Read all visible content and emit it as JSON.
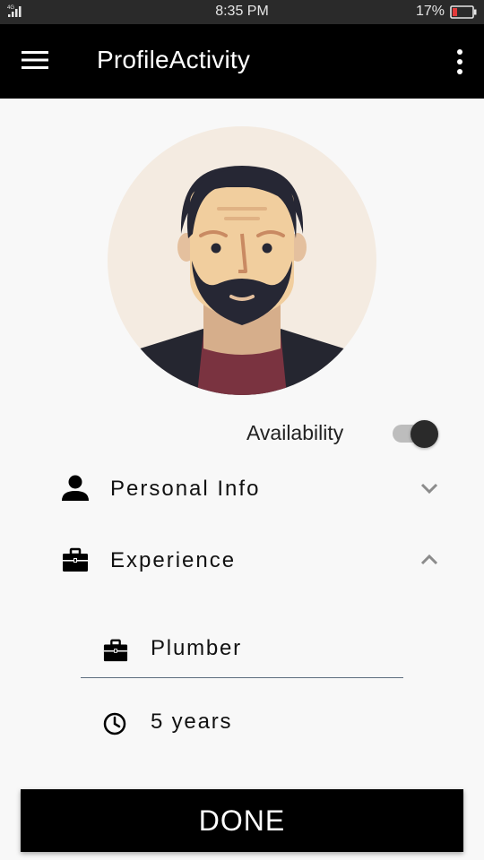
{
  "status_bar": {
    "network": "4G",
    "time": "8:35 PM",
    "battery": "17%"
  },
  "app_bar": {
    "title": "ProfileActivity",
    "menu_icon": "hamburger-menu-icon",
    "overflow_icon": "more-vert-icon"
  },
  "profile": {
    "avatar": "bearded-man-avatar"
  },
  "availability": {
    "label": "Availability",
    "enabled": true
  },
  "sections": [
    {
      "label": "Personal Info",
      "icon": "person-icon",
      "expanded": false
    },
    {
      "label": "Experience",
      "icon": "briefcase-icon",
      "expanded": true
    }
  ],
  "experience": {
    "occupation": "Plumber",
    "occupation_icon": "briefcase-icon",
    "duration": "5 years",
    "duration_icon": "clock-icon"
  },
  "actions": {
    "done_label": "DONE"
  }
}
